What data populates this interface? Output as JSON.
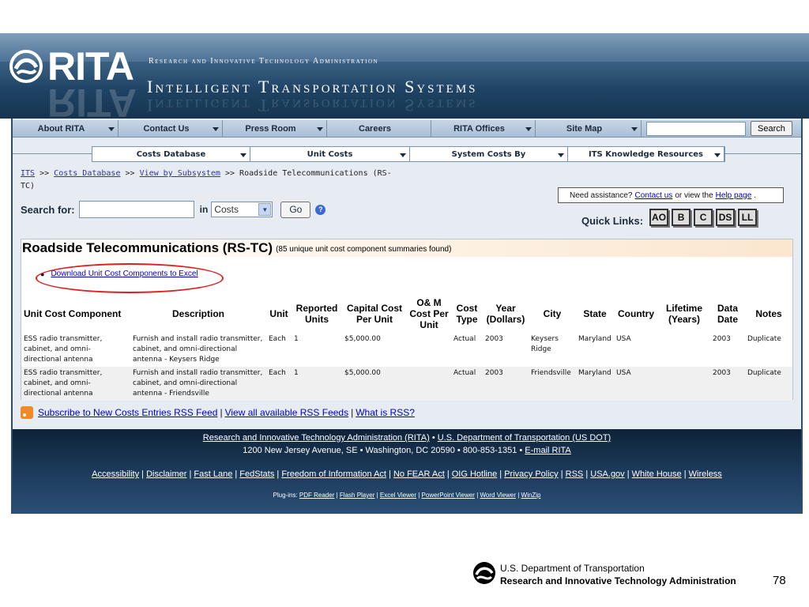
{
  "banner": {
    "logo_text": "RITA",
    "agency": "Research and Innovative Technology Administration",
    "site_title": "Intelligent Transportation Systems"
  },
  "topnav": {
    "items": [
      "About RITA",
      "Contact Us",
      "Press Room",
      "Careers",
      "RITA Offices",
      "Site Map"
    ],
    "search_button": "Search",
    "search_value": ""
  },
  "subnav": {
    "items": [
      "Costs Database",
      "Unit Costs",
      "System Costs By",
      "ITS Knowledge Resources"
    ]
  },
  "breadcrumb": {
    "links": [
      "ITS",
      "Costs Database",
      "View by Subsystem"
    ],
    "sep": ">>",
    "current": "Roadside Telecommunications (RS-TC)"
  },
  "search": {
    "label": "Search for:",
    "value": "",
    "in_label": "in",
    "selected": "Costs",
    "go": "Go"
  },
  "assist": {
    "text1": "Need assistance?",
    "link1": "Contact us",
    "text2": "or view the",
    "link2": "Help page",
    "text3": "."
  },
  "quicklinks": {
    "label": "Quick Links:",
    "items": [
      "AO",
      "B",
      "C",
      "DS",
      "LL"
    ]
  },
  "panel": {
    "title": "Roadside Telecommunications (RS-TC)",
    "count": "(85 unique unit cost component summaries found)",
    "download": "Download Unit Cost Components to Excel",
    "columns": [
      "Unit Cost Component",
      "Description",
      "Unit",
      "Reported Units",
      "Capital Cost Per Unit",
      "O& M Cost Per Unit",
      "Cost Type",
      "Year (Dollars)",
      "City",
      "State",
      "Country",
      "Lifetime (Years)",
      "Data Date",
      "Notes"
    ],
    "rows": [
      [
        "ESS radio transmitter, cabinet, and omni-directional antenna",
        "Furnish and install radio transmitter, cabinet, and omni-directional antenna - Keysers Ridge",
        "Each",
        "1",
        "$5,000.00",
        "",
        "Actual",
        "2003",
        "Keysers Ridge",
        "Maryland",
        "USA",
        "",
        "2003",
        "Duplicate"
      ],
      [
        "ESS radio transmitter, cabinet, and omni-directional antenna",
        "Furnish and install radio transmitter, cabinet, and omni-directional antenna - Friendsville",
        "Each",
        "1",
        "$5,000.00",
        "",
        "Actual",
        "2003",
        "Friendsville",
        "Maryland",
        "USA",
        "",
        "2003",
        "Duplicate"
      ]
    ]
  },
  "rss": {
    "link1": "Subscribe to New Costs Entries RSS Feed",
    "link2": "View all available RSS Feeds",
    "link3": "What is RSS?",
    "sep": "|"
  },
  "footer": {
    "line1_link1": "Research and Innovative Technology Administration (RITA)",
    "line1_sep": "•",
    "line1_link2": "U.S. Department of Transportation (US DOT)",
    "line2_text": "1200 New Jersey Avenue, SE • Washington, DC 20590 • 800-853-1351 •",
    "line2_link": "E-mail RITA",
    "links": [
      "Accessibility",
      "Disclaimer",
      "Fast Lane",
      "FedStats",
      "Freedom of Information Act",
      "No FEAR Act",
      "OIG Hotline",
      "Privacy Policy",
      "RSS",
      "USA.gov",
      "White House",
      "Wireless"
    ],
    "plugins_label": "Plug-ins:",
    "plugins": [
      "PDF Reader",
      "Flash Player",
      "Excel Viewer",
      "PowerPoint Viewer",
      "Word Viewer",
      "WinZip"
    ]
  },
  "slide_footer": {
    "dept": "U.S. Department of Transportation",
    "admin": "Research and Innovative Technology Administration",
    "page_number": "78"
  }
}
